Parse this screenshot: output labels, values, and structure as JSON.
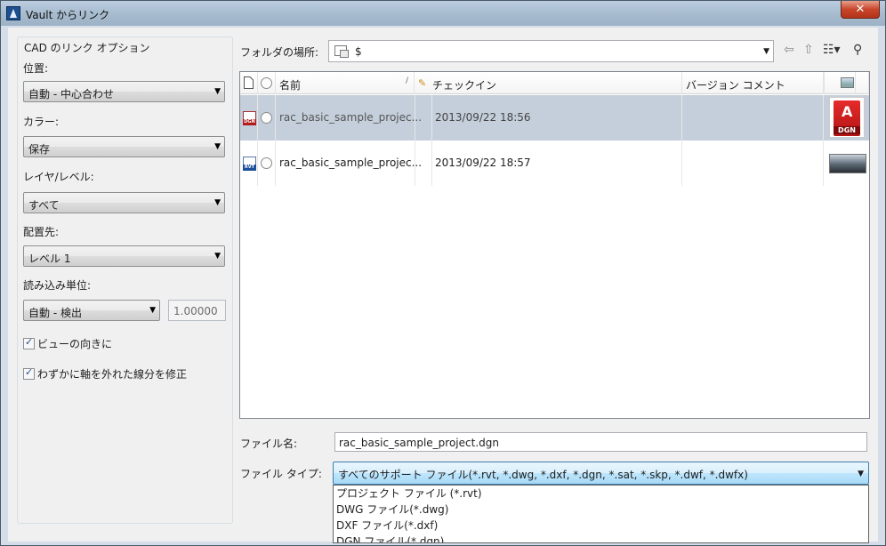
{
  "window": {
    "title": "Vault からリンク",
    "close_label": "✕"
  },
  "left": {
    "group_title": "CAD のリンク オプション",
    "position_label": "位置:",
    "position_value": "自動 - 中心合わせ",
    "color_label": "カラー:",
    "color_value": "保存",
    "layer_label": "レイヤ/レベル:",
    "layer_value": "すべて",
    "placement_label": "配置先:",
    "placement_value": "レベル 1",
    "units_label": "読み込み単位:",
    "units_value": "自動 - 検出",
    "scale_value": "1.00000",
    "orient_label": "ビューの向きに",
    "correct_label": "わずかに軸を外れた線分を修正"
  },
  "location": {
    "label": "フォルダの場所:",
    "value": "$"
  },
  "columns": {
    "name": "名前",
    "checkin": "チェックイン",
    "version_comment": "バージョン コメント"
  },
  "files": [
    {
      "name": "rac_basic_sample_projec...",
      "checkin": "2013/09/22 18:56",
      "type": "DGN",
      "selected": true
    },
    {
      "name": "rac_basic_sample_projec...",
      "checkin": "2013/09/22 18:57",
      "type": "RVT",
      "selected": false
    }
  ],
  "thumb_dgn_label": "DGN",
  "thumb_dgn_letter": "A",
  "filename": {
    "label": "ファイル名:",
    "value": "rac_basic_sample_project.dgn"
  },
  "filetype": {
    "label": "ファイル タイプ:",
    "value": "すべてのサポート ファイル(*.rvt, *.dwg, *.dxf, *.dgn, *.sat, *.skp, *.dwf, *.dwfx)",
    "options": [
      "プロジェクト ファイル (*.rvt)",
      "DWG ファイル(*.dwg)",
      "DXF ファイル(*.dxf)",
      "DGN ファイル(*.dgn)"
    ]
  }
}
